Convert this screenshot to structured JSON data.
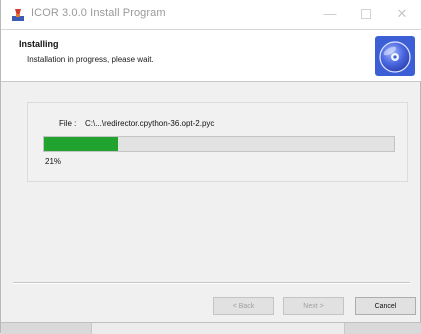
{
  "window": {
    "title": "ICOR 3.0.0 Install Program",
    "controls": {
      "minimize_glyph": "—",
      "close_glyph": "✕"
    }
  },
  "header": {
    "title": "Installing",
    "subtitle": "Installation in progress, please wait."
  },
  "content": {
    "file_label": "File :",
    "file_path": "C:\\...\\redirector.cpython-36.opt-2.pyc",
    "progress_percent": 21,
    "progress_text": "21%"
  },
  "footer": {
    "back_label": "< Back",
    "next_label": "Next >",
    "cancel_label": "Cancel"
  },
  "colors": {
    "progress_fill": "#21a330",
    "disc_icon": "#3d5fd6"
  },
  "icons": {
    "app": "installer-app-icon",
    "logo": "disc-icon"
  }
}
